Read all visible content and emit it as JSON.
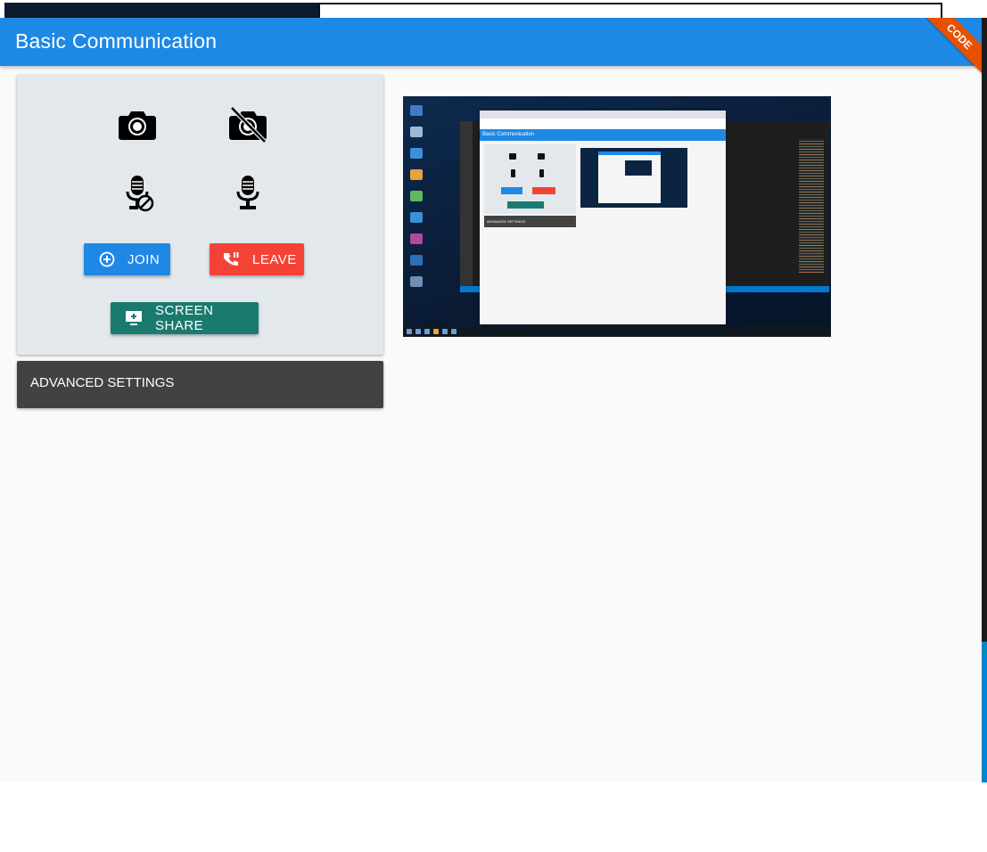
{
  "app": {
    "title": "Basic Communication",
    "ribbon_label": "CODE"
  },
  "controls": {
    "camera_on_icon": "camera-icon",
    "camera_off_icon": "camera-off-icon",
    "mic_off_icon": "mic-muted-icon",
    "mic_on_icon": "mic-icon",
    "join_label": "JOIN",
    "leave_label": "LEAVE",
    "screen_share_label": "SCREEN SHARE"
  },
  "advanced_settings": {
    "label": "ADVANCED SETTINGS"
  },
  "preview": {
    "inner_title": "Basic Communication",
    "inner_advanced": "ADVANCED SETTINGS"
  },
  "colors": {
    "app_bar": "#1e88e5",
    "join": "#1e88e5",
    "leave": "#f44336",
    "screen_share": "#1b7a6e",
    "ribbon": "#e65100",
    "advanced": "#424242"
  }
}
